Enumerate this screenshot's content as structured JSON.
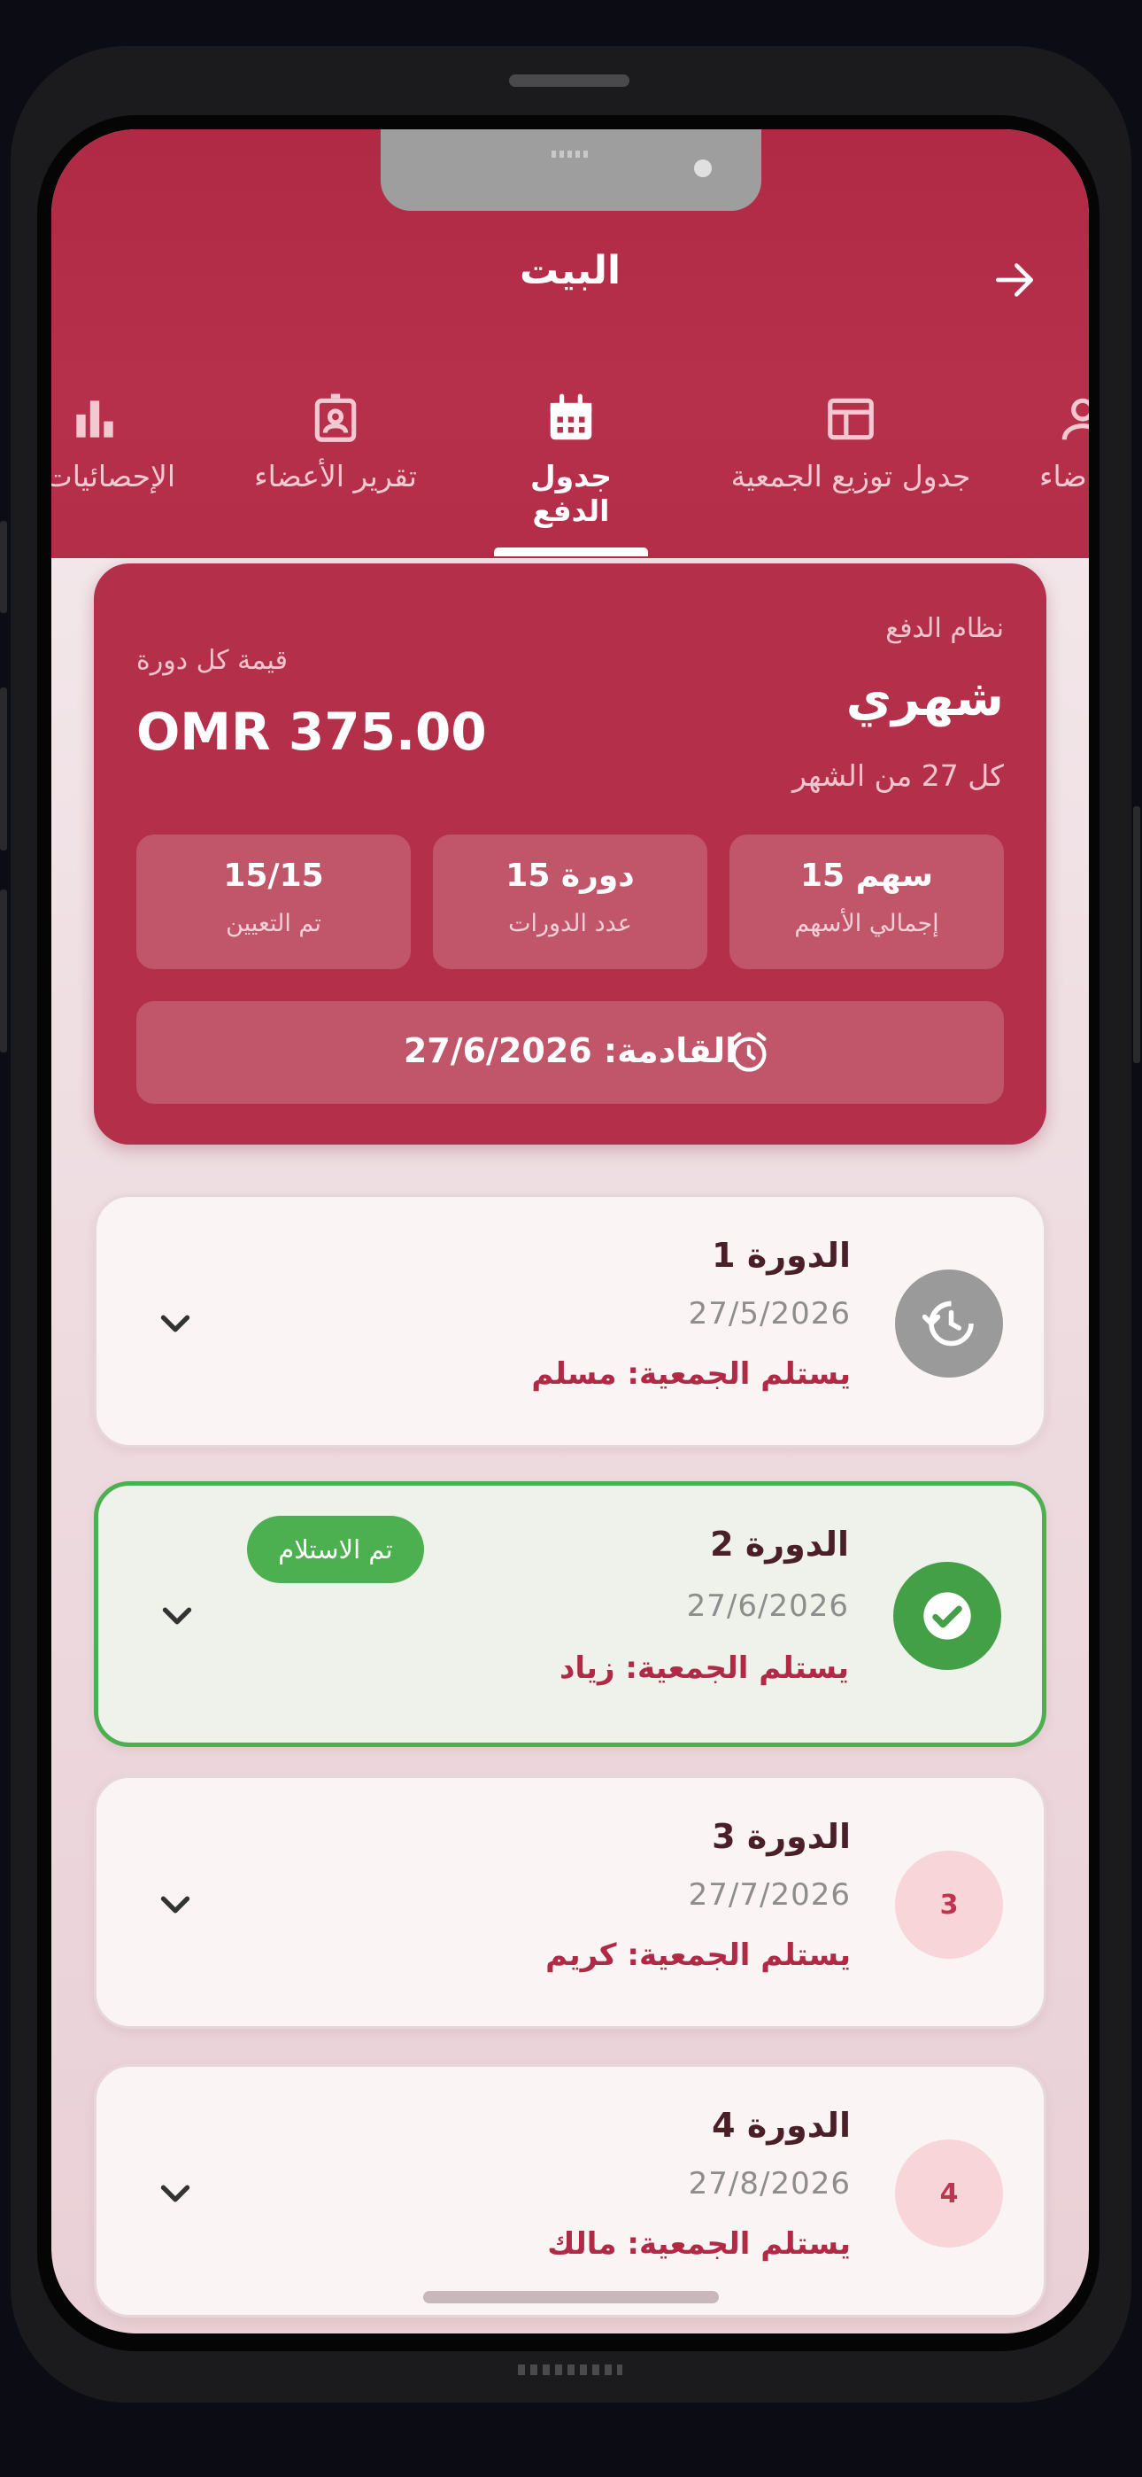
{
  "header": {
    "title": "البيت"
  },
  "tabs": [
    {
      "label": "ضاء",
      "icon": "person-icon"
    },
    {
      "label": "جدول توزيع الجمعية",
      "icon": "table-icon"
    },
    {
      "label": "جدول الدفع",
      "icon": "calendar-icon",
      "active": true
    },
    {
      "label": "تقرير الأعضاء",
      "icon": "badge-icon"
    },
    {
      "label": "الإحصائيات",
      "icon": "bar-chart-icon"
    }
  ],
  "summary": {
    "payment_system_label": "نظام الدفع",
    "payment_system_value": "شهري",
    "payment_day": "كل 27 من الشهر",
    "cycle_value_label": "قيمة كل دورة",
    "cycle_value": "OMR 375.00",
    "stats": [
      {
        "value": "15 سهم",
        "label": "إجمالي الأسهم"
      },
      {
        "value": "15 دورة",
        "label": "عدد الدورات"
      },
      {
        "value": "15/15",
        "label": "تم التعيين"
      }
    ],
    "next": "القادمة: 27/6/2026"
  },
  "cycles": [
    {
      "title": "الدورة 1",
      "date": "27/5/2026",
      "receiver": "يستلم الجمعية: مسلم",
      "badge": "history-icon"
    },
    {
      "title": "الدورة 2",
      "date": "27/6/2026",
      "receiver": "يستلم الجمعية: زياد",
      "badge": "check-icon",
      "status": "تم الاستلام"
    },
    {
      "title": "الدورة 3",
      "date": "27/7/2026",
      "receiver": "يستلم الجمعية: كريم",
      "badge": "3"
    },
    {
      "title": "الدورة 4",
      "date": "27/8/2026",
      "receiver": "يستلم الجمعية: مالك",
      "badge": "4"
    }
  ],
  "colors": {
    "primary": "#b4304a",
    "success": "#4caf50",
    "background": "#f6eef0"
  }
}
